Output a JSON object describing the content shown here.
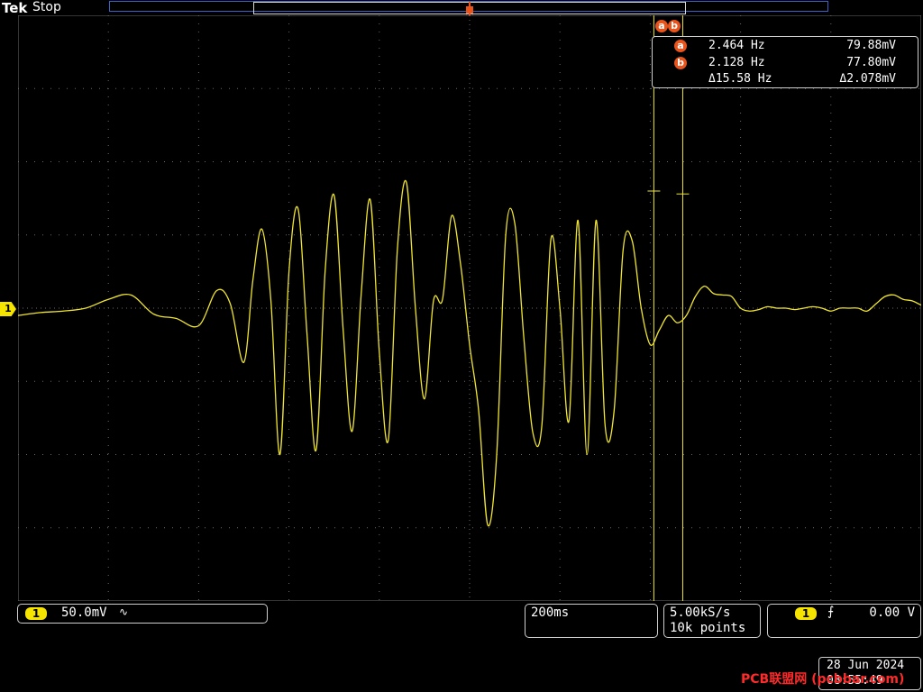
{
  "header": {
    "brand": "Tek",
    "status": "Stop"
  },
  "channel_marker": "1",
  "cursor_readout": {
    "badge_a": "a",
    "badge_b": "b",
    "rows": [
      {
        "label": "a",
        "v1": "2.464 Hz",
        "v2": "79.88mV"
      },
      {
        "label": "b",
        "v1": "2.128 Hz",
        "v2": "77.80mV"
      },
      {
        "label": "",
        "v1": "Δ15.58 Hz",
        "v2": "Δ2.078mV"
      }
    ]
  },
  "bottom": {
    "ch1_badge": "1",
    "ch1_scale": "50.0mV",
    "ch1_coupling_symbol": "∿",
    "timebase": "200ms",
    "sample_rate": "5.00kS/s",
    "record_length": "10k points",
    "trigger_badge": "1",
    "trigger_slope_symbol": "⨍",
    "trigger_level": "0.00 V"
  },
  "datetime": {
    "date": "28 Jun 2024",
    "time": "08:55:49"
  },
  "watermark": "PCB联盟网 (pcbbar.com)",
  "colors": {
    "trace": "#f0e530",
    "graticule": "#6a6a6a",
    "cursor": "#f0e530",
    "badge": "#e8541b",
    "record_bar": "#3a63c8"
  },
  "chart_data": {
    "type": "line",
    "title": "",
    "xlabel": "",
    "ylabel": "",
    "x_unit": "ms",
    "y_unit": "mV",
    "xlim": [
      -1000,
      1000
    ],
    "ylim": [
      -200,
      200
    ],
    "grid": true,
    "series": [
      {
        "name": "",
        "x": [
          -1000,
          -950,
          -900,
          -850,
          -800,
          -750,
          -700,
          -650,
          -600,
          -560,
          -530,
          -500,
          -480,
          -460,
          -440,
          -420,
          -400,
          -380,
          -360,
          -340,
          -320,
          -300,
          -280,
          -260,
          -240,
          -220,
          -200,
          -180,
          -160,
          -140,
          -120,
          -100,
          -80,
          -60,
          -40,
          -20,
          0,
          20,
          40,
          60,
          80,
          100,
          120,
          140,
          160,
          180,
          200,
          220,
          240,
          260,
          280,
          300,
          320,
          340,
          360,
          380,
          400,
          420,
          440,
          460,
          480,
          500,
          520,
          540,
          560,
          580,
          600,
          620,
          640,
          660,
          680,
          700,
          720,
          740,
          760,
          780,
          800,
          820,
          840,
          860,
          880,
          900,
          920,
          940,
          960,
          980,
          1000
        ],
        "y": [
          -5,
          -3,
          -2,
          0,
          6,
          9,
          -4,
          -7,
          -12,
          12,
          3,
          -37,
          19,
          54,
          5,
          -100,
          25,
          68,
          -18,
          -97,
          25,
          77,
          -15,
          -84,
          10,
          74,
          -30,
          -90,
          40,
          86,
          0,
          -62,
          5,
          6,
          63,
          30,
          -25,
          -70,
          -148,
          -100,
          50,
          58,
          -20,
          -85,
          -80,
          47,
          0,
          -77,
          60,
          -100,
          60,
          -80,
          -70,
          40,
          46,
          0,
          -25,
          -15,
          -5,
          -10,
          -5,
          8,
          15,
          10,
          9,
          8,
          0,
          -2,
          -1,
          1,
          0,
          0,
          -1,
          0,
          1,
          0,
          -2,
          0,
          0,
          0,
          -2,
          3,
          8,
          9,
          6,
          5,
          2
        ],
        "style": "yellow trace"
      }
    ],
    "cursors": {
      "a": {
        "x": 408,
        "value_label": "2.464 Hz",
        "y_label": "79.88mV"
      },
      "b": {
        "x": 472,
        "value_label": "2.128 Hz",
        "y_label": "77.80mV"
      }
    }
  }
}
